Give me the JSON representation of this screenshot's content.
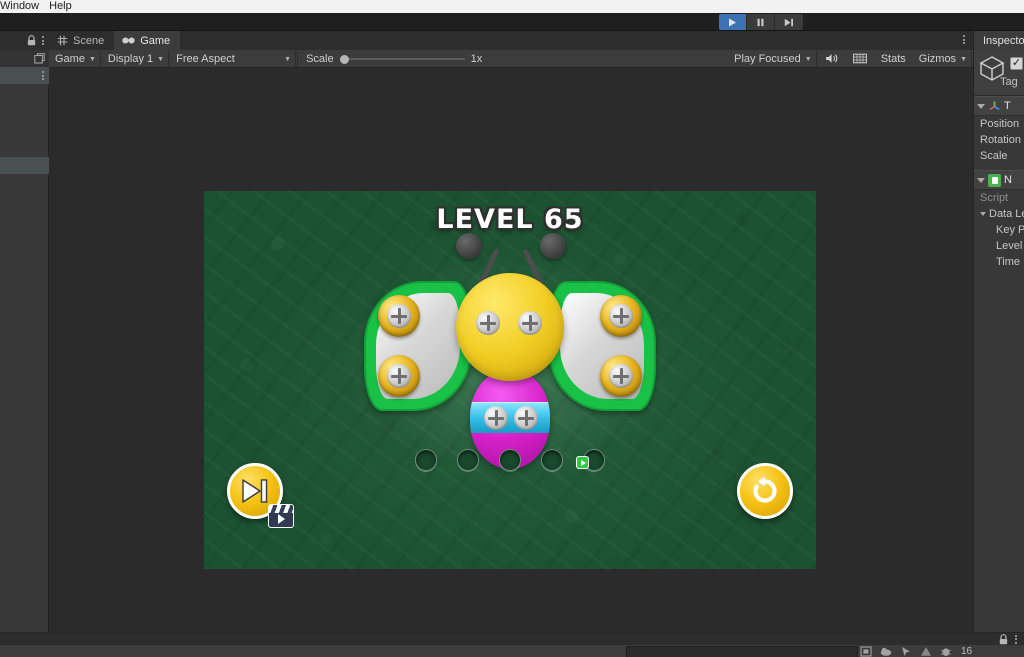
{
  "os_menu": {
    "items": [
      "Window",
      "Help"
    ]
  },
  "toolbar": {
    "play_label": "Play",
    "pause_label": "Pause",
    "step_label": "Step"
  },
  "left_dock": {
    "lock_icon": "lock-icon",
    "menu_icon": "kebab-menu-icon"
  },
  "gameview": {
    "tabs": [
      {
        "label": "Scene",
        "icon": "scene-grid-icon",
        "active": false
      },
      {
        "label": "Game",
        "icon": "game-controller-icon",
        "active": true
      }
    ],
    "controls": {
      "display_target": "Game",
      "display": "Display 1",
      "aspect": "Free Aspect",
      "scale_label": "Scale",
      "scale_value": "1x",
      "play_mode": "Play Focused",
      "mute_icon": "speaker-icon",
      "stats_label": "Stats",
      "gizmos_label": "Gizmos"
    }
  },
  "game": {
    "level_title": "LEVEL 65",
    "background_color": "#1c5231",
    "butterfly": {
      "head_color": "#f2cf25",
      "body_color": "#d621c9",
      "band_color": "#35bfe8",
      "wing_outer_color": "#19c246",
      "wing_inner_color": "#d8d8d8",
      "antenna_color": "#4d4d4d",
      "screws": [
        {
          "id": "wing-left-top",
          "socket": "gold"
        },
        {
          "id": "wing-left-bottom",
          "socket": "gold"
        },
        {
          "id": "wing-right-top",
          "socket": "gold"
        },
        {
          "id": "wing-right-bottom",
          "socket": "gold"
        },
        {
          "id": "head-left",
          "socket": "none"
        },
        {
          "id": "head-right",
          "socket": "none"
        },
        {
          "id": "band-left",
          "socket": "none"
        },
        {
          "id": "band-right",
          "socket": "none"
        }
      ]
    },
    "slots": [
      {
        "id": 1,
        "filled": false,
        "badge": null
      },
      {
        "id": 2,
        "filled": false,
        "badge": null
      },
      {
        "id": 3,
        "filled": false,
        "badge": null
      },
      {
        "id": 4,
        "filled": false,
        "badge": null
      },
      {
        "id": 5,
        "filled": false,
        "badge": "video-play-badge"
      }
    ],
    "buttons": {
      "skip": {
        "name": "skip-level-button",
        "icon": "skip-forward-icon",
        "badge_icon": "clapperboard-icon"
      },
      "restart": {
        "name": "restart-level-button",
        "icon": "restart-arrow-icon"
      }
    }
  },
  "inspector": {
    "tab_label": "Inspector",
    "tab_icon": "info-icon",
    "object_icon": "cube-icon",
    "enabled": true,
    "check_glyph": "✓",
    "tag_label": "Tag",
    "components": [
      {
        "title": "T",
        "icon": "transform-icon",
        "properties": [
          "Position",
          "Rotation",
          "Scale"
        ]
      },
      {
        "title": "N",
        "icon": "script-icon",
        "properties": [
          "Script",
          "Data Lev",
          "Key P",
          "Level",
          "Time"
        ]
      }
    ]
  },
  "statusbar": {
    "lock_icon": "lock-icon",
    "menu_icon": "kebab-menu-icon",
    "search_placeholder": "",
    "icons": [
      "collab-icon",
      "cloud-icon",
      "cursor-icon",
      "asset-icon",
      "bug-icon"
    ],
    "count": "16"
  }
}
